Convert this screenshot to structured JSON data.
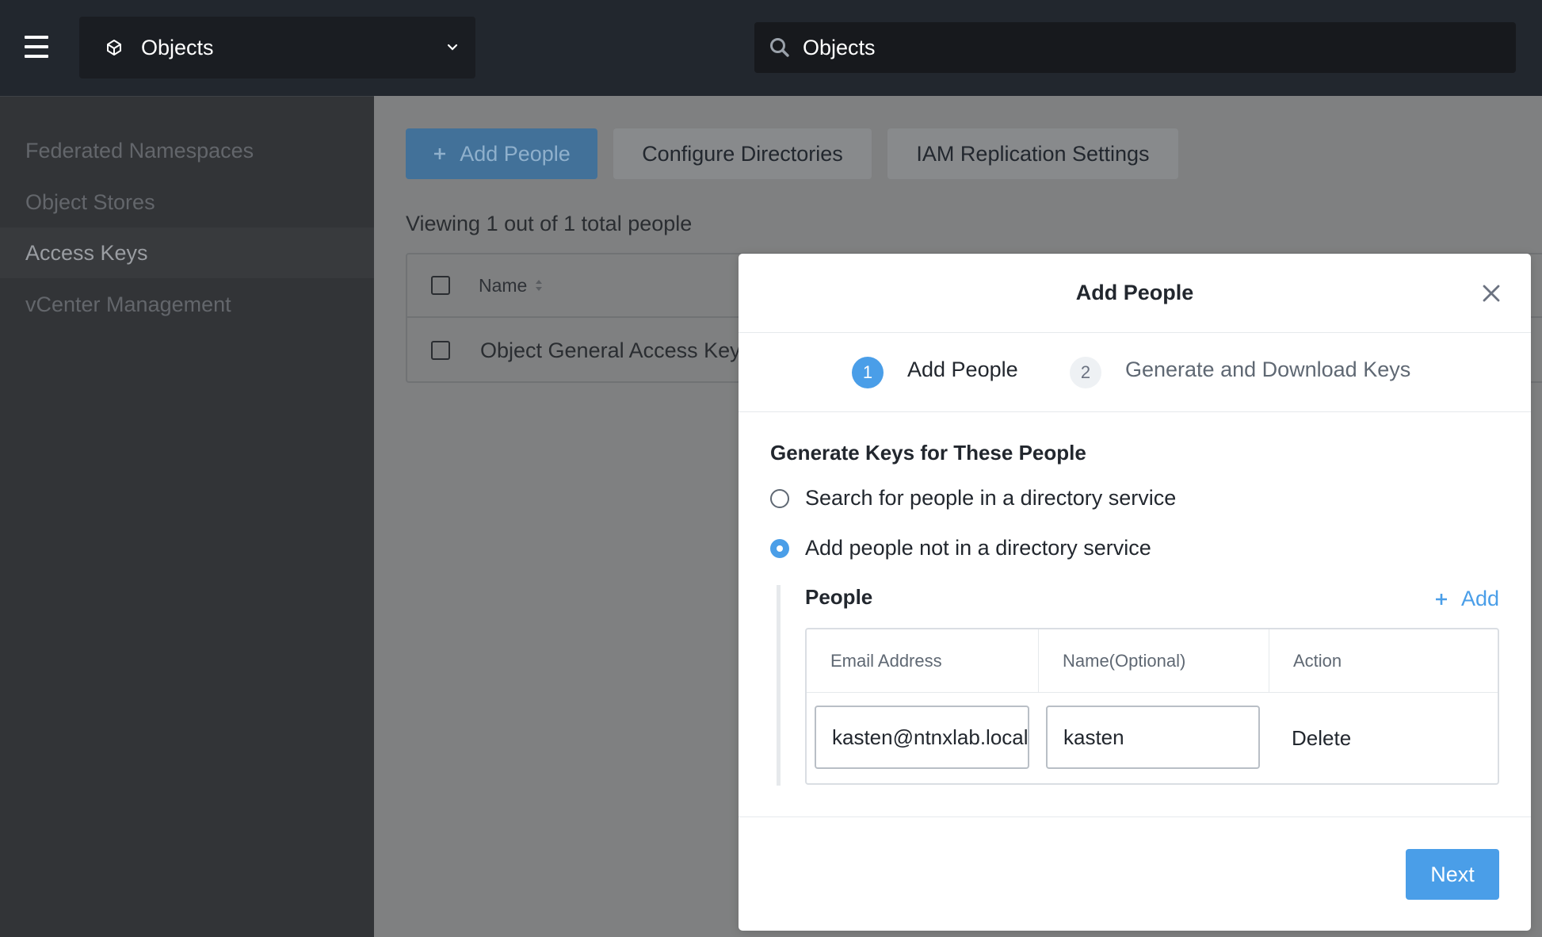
{
  "header": {
    "app_name": "Objects",
    "search_value": "Objects",
    "icons": {
      "menu": "hamburger-icon",
      "app": "objects-icon",
      "chevron": "chevron-down-icon",
      "search": "search-icon"
    }
  },
  "sidebar": {
    "items": [
      {
        "label": "Federated Namespaces",
        "active": false
      },
      {
        "label": "Object Stores",
        "active": false
      },
      {
        "label": "Access Keys",
        "active": true
      },
      {
        "label": "vCenter Management",
        "active": false
      }
    ]
  },
  "toolbar": {
    "add_people_label": "Add People",
    "configure_directories_label": "Configure Directories",
    "iam_replication_label": "IAM Replication Settings"
  },
  "listing": {
    "viewing_text": "Viewing 1 out of 1 total people",
    "columns": [
      "Name"
    ],
    "rows": [
      {
        "name": "Object General Access Key"
      }
    ]
  },
  "modal": {
    "title": "Add People",
    "steps": [
      {
        "number": "1",
        "label": "Add People",
        "active": true
      },
      {
        "number": "2",
        "label": "Generate and Download Keys",
        "active": false
      }
    ],
    "section_title": "Generate Keys for These People",
    "options": [
      {
        "label": "Search for people in a directory service",
        "checked": false
      },
      {
        "label": "Add people not in a directory service",
        "checked": true
      }
    ],
    "people": {
      "label": "People",
      "add_label": "Add",
      "columns": [
        "Email Address",
        "Name(Optional)",
        "Action"
      ],
      "rows": [
        {
          "email": "kasten@ntnxlab.local",
          "name": "kasten",
          "action": "Delete"
        }
      ]
    },
    "next_label": "Next"
  },
  "colors": {
    "accent": "#4a9ee8",
    "topbar": "#22272e",
    "sidebar": "#323437"
  }
}
